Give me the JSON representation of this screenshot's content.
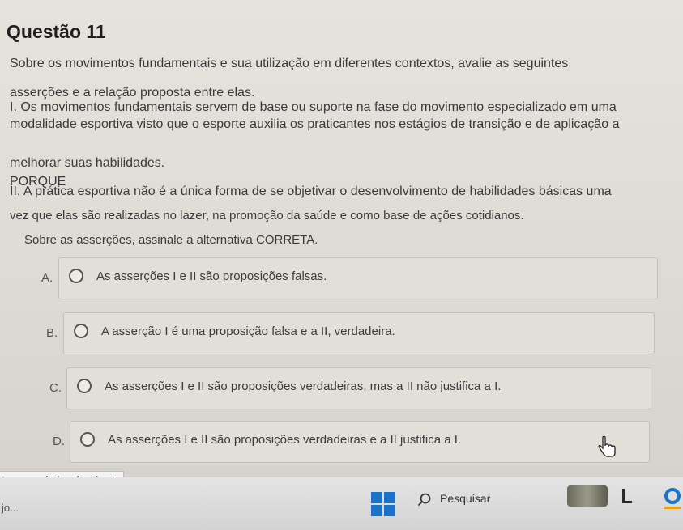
{
  "question": {
    "title": "Questão 11",
    "lines": [
      "Sobre os movimentos fundamentais e sua utilização em diferentes contextos, avalie as seguintes",
      "asserções e a relação proposta entre elas.",
      "I. Os movimentos fundamentais servem de base ou suporte na fase do movimento especializado em uma",
      "modalidade esportiva visto que o esporte auxilia os praticantes nos estágios de transição e de aplicação a",
      "melhorar suas habilidades.",
      "PORQUE",
      "II. A prática esportiva não é a única forma de se objetivar o desenvolvimento de habilidades básicas uma",
      "vez que elas são realizadas no lazer, na promoção da saúde e como base de ações cotidianos.",
      "Sobre as asserções, assinale a alternativa CORRETA."
    ]
  },
  "options": [
    {
      "letter": "A.",
      "text": "As asserções I e II são proposições falsas."
    },
    {
      "letter": "B.",
      "text": "A asserção I é uma proposição falsa e a II, verdadeira."
    },
    {
      "letter": "C.",
      "text": "As asserções I e II são proposições verdadeiras, mas a II não justifica a I."
    },
    {
      "letter": "D.",
      "text": "As asserções I e II são proposições verdadeiras e a II justifica a I."
    }
  ],
  "status_bar": {
    "url": "ton.com.br/evaluation#"
  },
  "taskbar": {
    "left_text": "jo...",
    "search_label": "Pesquisar",
    "accent_color": "#1a73c9"
  }
}
